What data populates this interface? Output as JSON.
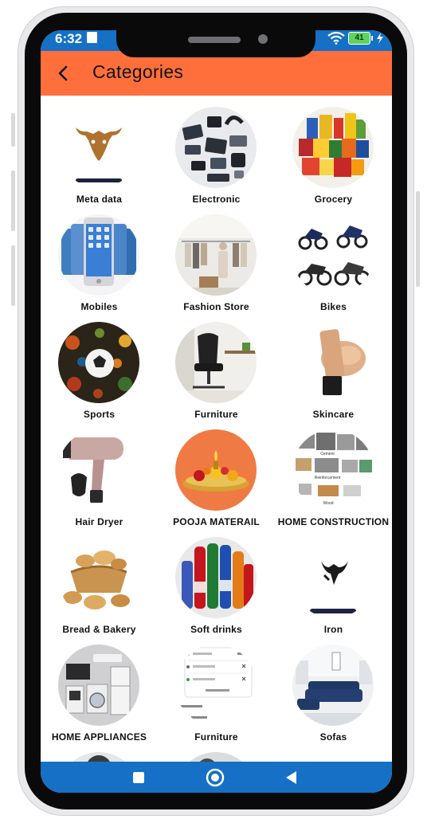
{
  "status": {
    "time": "6:32",
    "battery": "41"
  },
  "header": {
    "title": "Categories"
  },
  "categories": [
    {
      "label": "Meta data"
    },
    {
      "label": "Electronic"
    },
    {
      "label": "Grocery"
    },
    {
      "label": "Mobiles"
    },
    {
      "label": "Fashion Store"
    },
    {
      "label": "Bikes"
    },
    {
      "label": "Sports"
    },
    {
      "label": "Furniture"
    },
    {
      "label": "Skincare"
    },
    {
      "label": "Hair Dryer"
    },
    {
      "label": "POOJA MATERAIL"
    },
    {
      "label": "HOME CONSTRUCTION"
    },
    {
      "label": "Bread & Bakery"
    },
    {
      "label": "Soft drinks"
    },
    {
      "label": "Iron"
    },
    {
      "label": "HOME APPLIANCES"
    },
    {
      "label": "Furniture"
    },
    {
      "label": "Sofas"
    }
  ],
  "construction_labels": [
    "Cement",
    "Reinforcement",
    "Wood"
  ],
  "colors": {
    "statusbar": "#1570c6",
    "appbar": "#ff6f3c",
    "navbar": "#1570c6"
  }
}
